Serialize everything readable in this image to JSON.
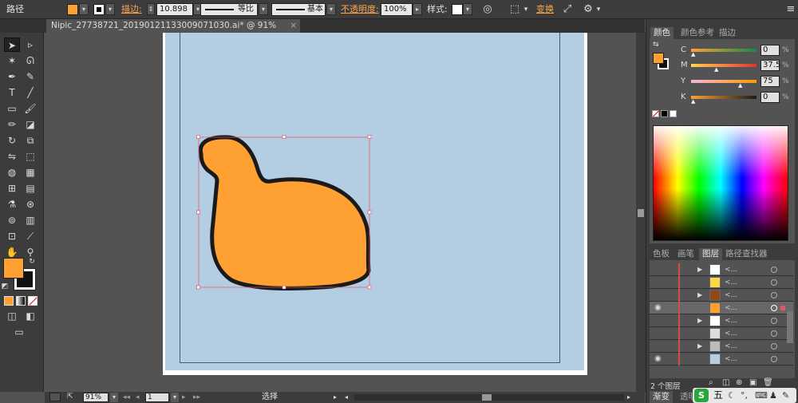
{
  "control_bar": {
    "mode_label": "路径",
    "fill_color": "#ffa032",
    "stroke_label": "描边:",
    "stroke_weight": "10.898",
    "profile_label": "等比",
    "brush_label": "基本",
    "opacity_label": "不透明度:",
    "opacity_value": "100%",
    "style_label": "样式:",
    "transform_label": "变换"
  },
  "document_tab": {
    "title": "Nipic_27738721_20190121133009071030.ai* @ 91% (CMYK/预览)",
    "close": "×"
  },
  "colors": {
    "fill": "#ffa032",
    "artboard_bg": "#b3cde2",
    "shape_stroke": "#1a1a1a",
    "selection": "#e0566b"
  },
  "color_panel": {
    "tabs": [
      "颜色",
      "颜色参考",
      "描边"
    ],
    "channels": [
      {
        "label": "C",
        "value": "0",
        "unit": "%"
      },
      {
        "label": "M",
        "value": "37.5",
        "unit": "%"
      },
      {
        "label": "Y",
        "value": "75",
        "unit": "%"
      },
      {
        "label": "K",
        "value": "0",
        "unit": "%"
      }
    ]
  },
  "layers_panel": {
    "tabs": [
      "色板",
      "画笔",
      "图层",
      "路径查找器"
    ],
    "rows": [
      {
        "name": "<...",
        "expanded": true
      },
      {
        "name": "<...",
        "expanded": false
      },
      {
        "name": "<...",
        "expanded": true
      },
      {
        "name": "<...",
        "expanded": false
      },
      {
        "name": "<...",
        "expanded": true
      },
      {
        "name": "<...",
        "expanded": false
      },
      {
        "name": "<...",
        "expanded": true
      },
      {
        "name": "<...",
        "expanded": false
      }
    ],
    "footer": "2 个图层",
    "bottom_tabs": [
      "渐变",
      "透明"
    ]
  },
  "status_bar": {
    "zoom": "91%",
    "page": "1",
    "tool_status": "选择"
  },
  "watermark": "五"
}
